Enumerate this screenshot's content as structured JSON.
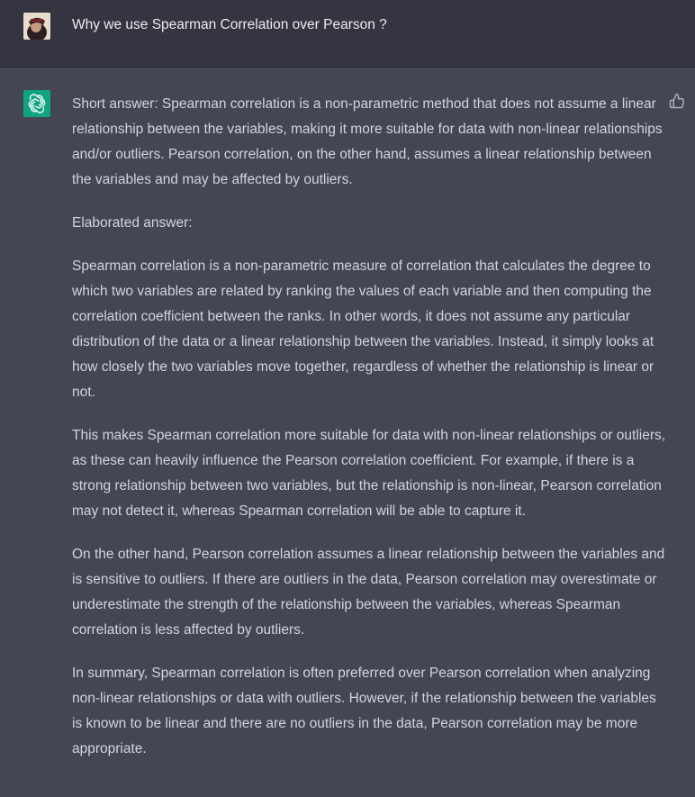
{
  "user_message": {
    "avatar_icon": "user-photo-avatar",
    "text": "Why we use Spearman Correlation over Pearson ?"
  },
  "assistant_message": {
    "avatar_icon": "openai-logo-icon",
    "accent_color": "#10a37f",
    "feedback_icon": "thumbs-up-icon",
    "paragraphs": [
      "Short answer: Spearman correlation is a non-parametric method that does not assume a linear relationship between the variables, making it more suitable for data with non-linear relationships and/or outliers. Pearson correlation, on the other hand, assumes a linear relationship between the variables and may be affected by outliers.",
      "Elaborated answer:",
      "Spearman correlation is a non-parametric measure of correlation that calculates the degree to which two variables are related by ranking the values of each variable and then computing the correlation coefficient between the ranks. In other words, it does not assume any particular distribution of the data or a linear relationship between the variables. Instead, it simply looks at how closely the two variables move together, regardless of whether the relationship is linear or not.",
      "This makes Spearman correlation more suitable for data with non-linear relationships or outliers, as these can heavily influence the Pearson correlation coefficient. For example, if there is a strong relationship between two variables, but the relationship is non-linear, Pearson correlation may not detect it, whereas Spearman correlation will be able to capture it.",
      "On the other hand, Pearson correlation assumes a linear relationship between the variables and is sensitive to outliers. If there are outliers in the data, Pearson correlation may overestimate or underestimate the strength of the relationship between the variables, whereas Spearman correlation is less affected by outliers.",
      "In summary, Spearman correlation is often preferred over Pearson correlation when analyzing non-linear relationships or data with outliers. However, if the relationship between the variables is known to be linear and there are no outliers in the data, Pearson correlation may be more appropriate."
    ]
  }
}
